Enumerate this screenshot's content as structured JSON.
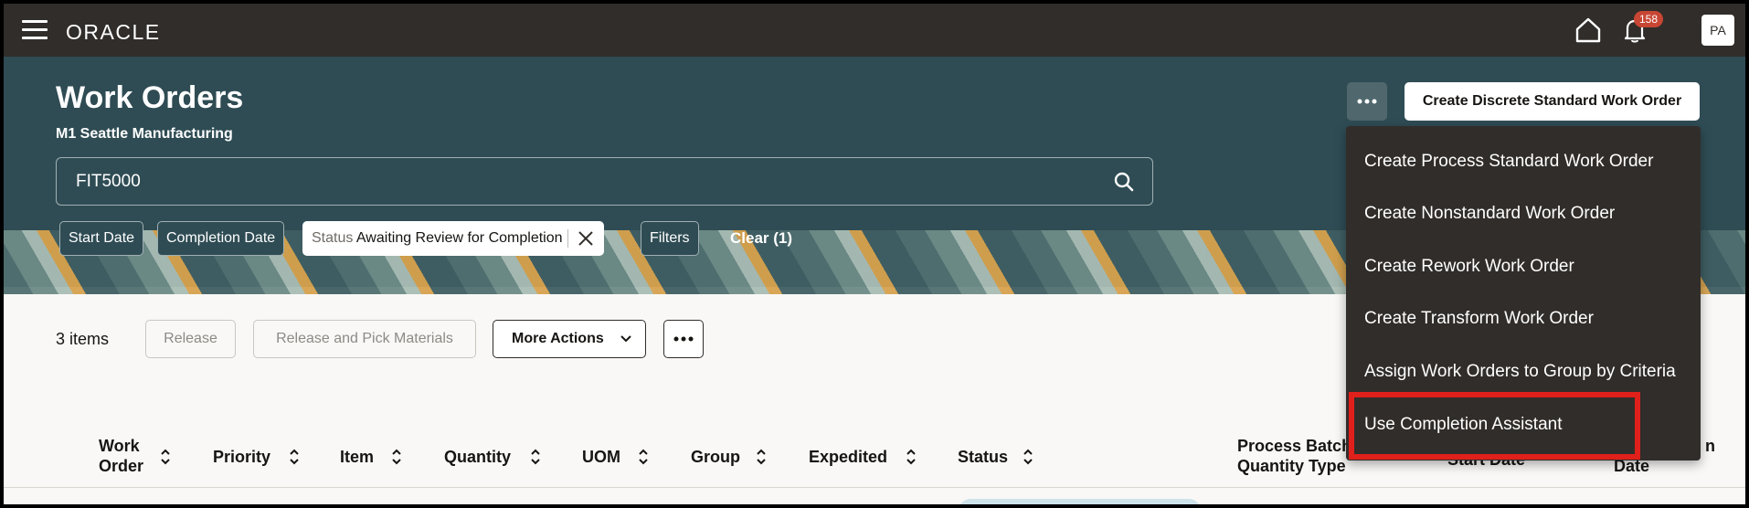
{
  "topbar": {
    "logo": "ORACLE",
    "notification_count": "158",
    "avatar_initials": "PA"
  },
  "header": {
    "title": "Work Orders",
    "subtitle": "M1 Seattle Manufacturing",
    "search_value": "FIT5000",
    "filters": {
      "start_date": "Start Date",
      "completion_date": "Completion Date",
      "status_key": "Status",
      "status_value": "Awaiting Review for Completion",
      "filters": "Filters",
      "clear": "Clear (1)"
    },
    "create_discrete": "Create Discrete Standard Work Order"
  },
  "dropdown": {
    "items": [
      "Create Process Standard Work Order",
      "Create Nonstandard Work Order",
      "Create Rework Work Order",
      "Create Transform Work Order",
      "Assign Work Orders to Group by Criteria",
      "Use Completion Assistant"
    ]
  },
  "toolbar": {
    "items_count": "3 items",
    "release": "Release",
    "release_pick": "Release and Pick Materials",
    "more_actions": "More Actions"
  },
  "table": {
    "columns": {
      "work_order_1": "Work",
      "work_order_2": "Order",
      "priority": "Priority",
      "item": "Item",
      "quantity": "Quantity",
      "uom": "UOM",
      "group": "Group",
      "expedited": "Expedited",
      "status": "Status",
      "process_batch_1": "Process Batch",
      "process_batch_2": "Quantity Type",
      "start_date": "Start Date",
      "completion_1": "n",
      "completion_2": "Date"
    }
  }
}
